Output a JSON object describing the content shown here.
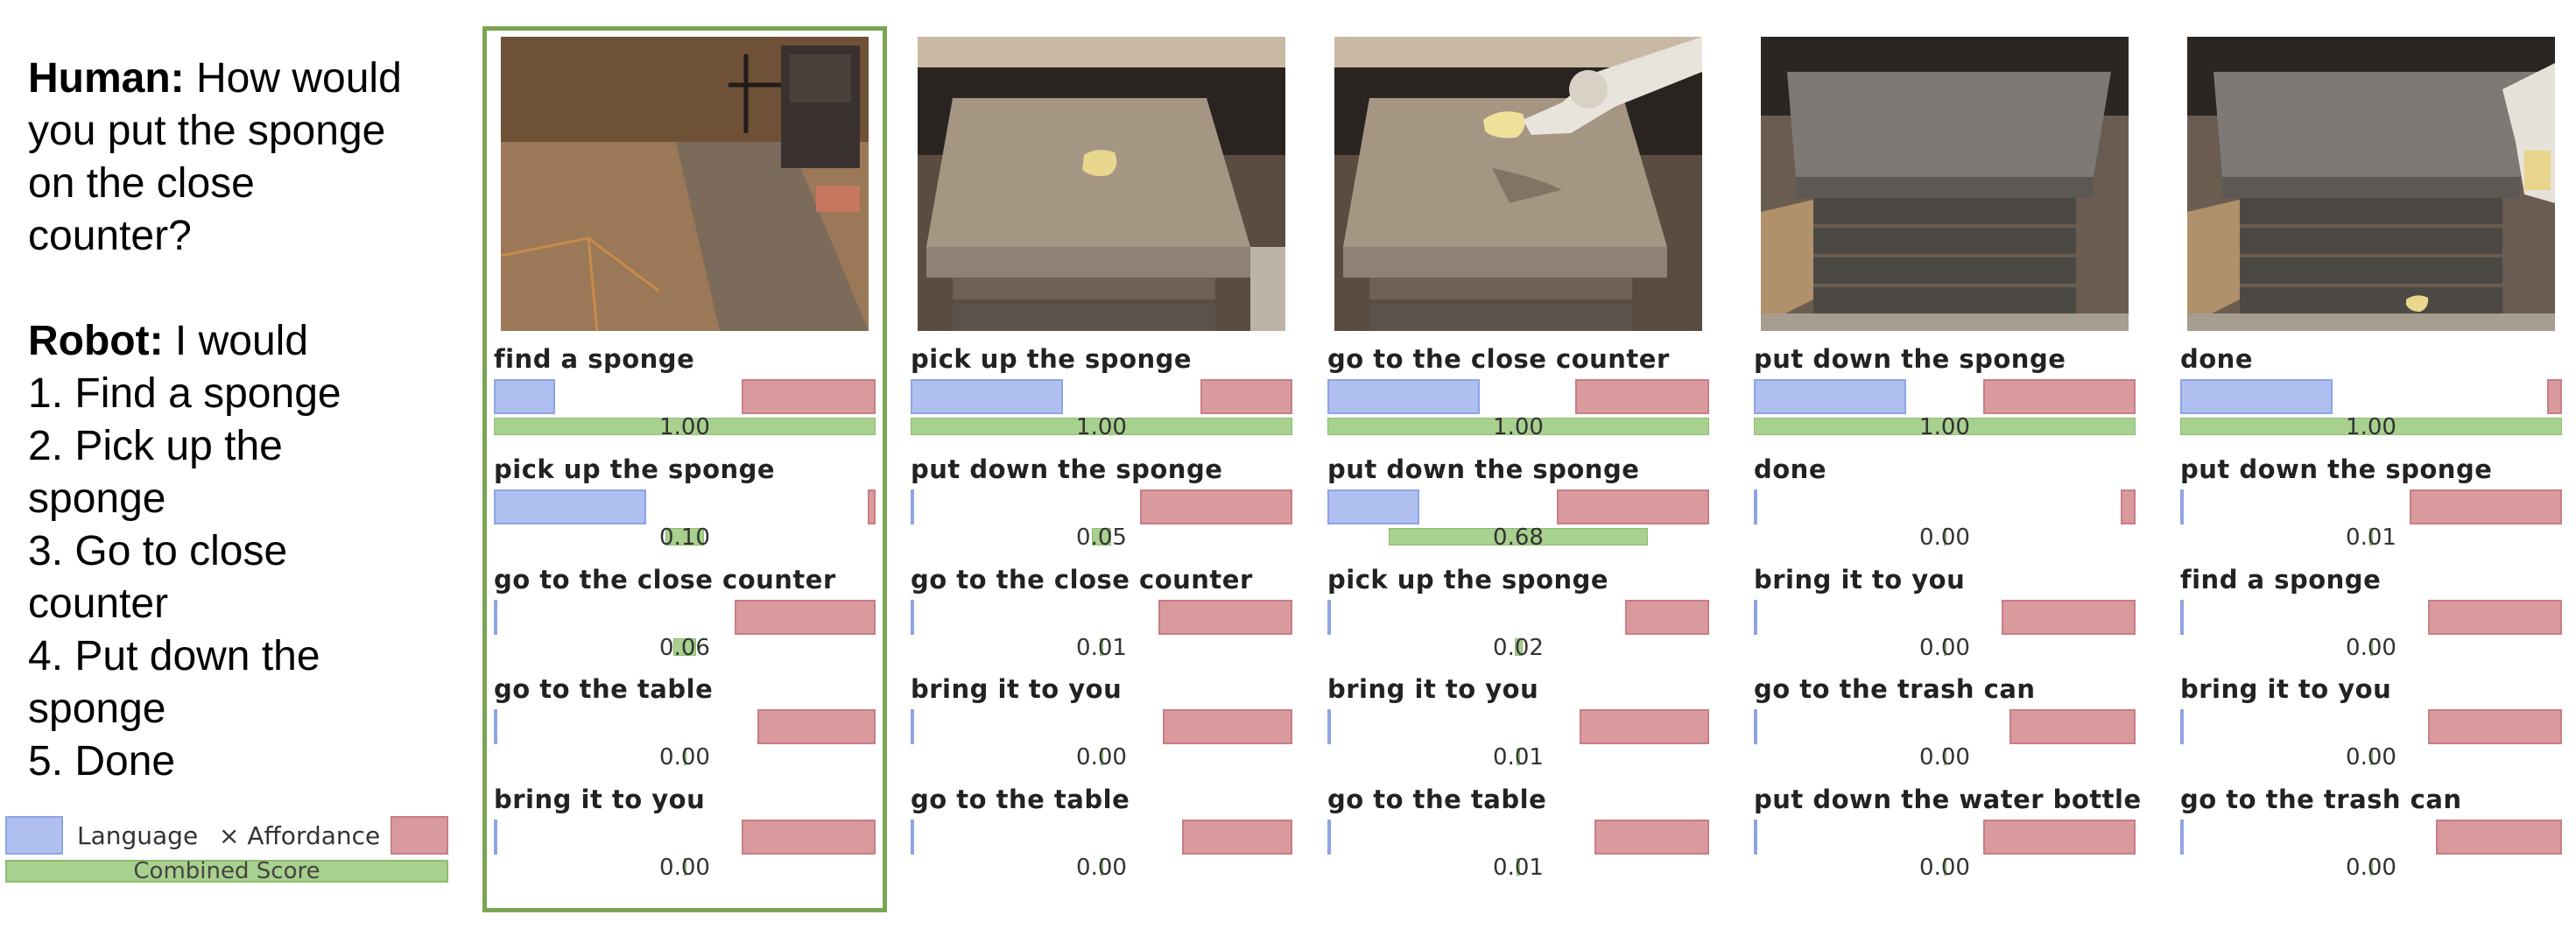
{
  "dialog": {
    "human_label": "Human:",
    "human_text": [
      " How would",
      "you put the sponge",
      "on the close",
      "counter?"
    ],
    "robot_label": "Robot:",
    "robot_text": [
      " I would",
      "1. Find a sponge",
      "2. Pick up the",
      "sponge",
      "3. Go to close",
      "counter",
      "4. Put down the",
      "sponge",
      "5. Done"
    ]
  },
  "legend": {
    "language": "Language",
    "affordance": "× Affordance",
    "combined": "Combined Score"
  },
  "colors": {
    "language": "#aebff0",
    "affordance": "#d99a9e",
    "combined": "#a8d08e",
    "highlight": "#7aa653"
  },
  "chart_data": {
    "type": "bar",
    "steps": [
      {
        "scene": "kitchen-floor",
        "skills": [
          {
            "name": "find a sponge",
            "language": 0.16,
            "affordance": 0.35,
            "score": "1.00",
            "combined": 1.0
          },
          {
            "name": "pick up the sponge",
            "language": 0.4,
            "affordance": 0.02,
            "score": "0.10",
            "combined": 0.1
          },
          {
            "name": "go to the close counter",
            "language": 0.01,
            "affordance": 0.37,
            "score": "0.06",
            "combined": 0.06
          },
          {
            "name": "go to the table",
            "language": 0.01,
            "affordance": 0.31,
            "score": "0.00",
            "combined": 0.0
          },
          {
            "name": "bring it to you",
            "language": 0.01,
            "affordance": 0.35,
            "score": "0.00",
            "combined": 0.0
          }
        ]
      },
      {
        "scene": "sponge-on-counter",
        "skills": [
          {
            "name": "pick up the sponge",
            "language": 0.4,
            "affordance": 0.24,
            "score": "1.00",
            "combined": 1.0
          },
          {
            "name": "put down the sponge",
            "language": 0.01,
            "affordance": 0.4,
            "score": "0.05",
            "combined": 0.05
          },
          {
            "name": "go to the close counter",
            "language": 0.01,
            "affordance": 0.35,
            "score": "0.01",
            "combined": 0.01
          },
          {
            "name": "bring it to you",
            "language": 0.01,
            "affordance": 0.34,
            "score": "0.00",
            "combined": 0.0
          },
          {
            "name": "go to the table",
            "language": 0.01,
            "affordance": 0.29,
            "score": "0.00",
            "combined": 0.0
          }
        ]
      },
      {
        "scene": "robot-holding-sponge",
        "skills": [
          {
            "name": "go to the close counter",
            "language": 0.4,
            "affordance": 0.35,
            "score": "1.00",
            "combined": 1.0
          },
          {
            "name": "put down the sponge",
            "language": 0.24,
            "affordance": 0.4,
            "score": "0.68",
            "combined": 0.68
          },
          {
            "name": "pick up the sponge",
            "language": 0.01,
            "affordance": 0.22,
            "score": "0.02",
            "combined": 0.02
          },
          {
            "name": "bring it to you",
            "language": 0.01,
            "affordance": 0.34,
            "score": "0.01",
            "combined": 0.01
          },
          {
            "name": "go to the table",
            "language": 0.01,
            "affordance": 0.3,
            "score": "0.01",
            "combined": 0.01
          }
        ]
      },
      {
        "scene": "close-counter",
        "skills": [
          {
            "name": "put down the sponge",
            "language": 0.4,
            "affordance": 0.4,
            "score": "1.00",
            "combined": 1.0
          },
          {
            "name": "done",
            "language": 0.01,
            "affordance": 0.04,
            "score": "0.00",
            "combined": 0.0
          },
          {
            "name": "bring it to you",
            "language": 0.01,
            "affordance": 0.35,
            "score": "0.00",
            "combined": 0.0
          },
          {
            "name": "go to the trash can",
            "language": 0.01,
            "affordance": 0.33,
            "score": "0.00",
            "combined": 0.0
          },
          {
            "name": "put down the water bottle",
            "language": 0.01,
            "affordance": 0.4,
            "score": "0.00",
            "combined": 0.0
          }
        ]
      },
      {
        "scene": "counter-with-sponge",
        "skills": [
          {
            "name": "done",
            "language": 0.4,
            "affordance": 0.04,
            "score": "1.00",
            "combined": 1.0
          },
          {
            "name": "put down the sponge",
            "language": 0.01,
            "affordance": 0.4,
            "score": "0.01",
            "combined": 0.01
          },
          {
            "name": "find a sponge",
            "language": 0.01,
            "affordance": 0.35,
            "score": "0.00",
            "combined": 0.0
          },
          {
            "name": "bring it to you",
            "language": 0.01,
            "affordance": 0.35,
            "score": "0.00",
            "combined": 0.0
          },
          {
            "name": "go to the trash can",
            "language": 0.01,
            "affordance": 0.33,
            "score": "0.00",
            "combined": 0.0
          }
        ]
      }
    ]
  }
}
